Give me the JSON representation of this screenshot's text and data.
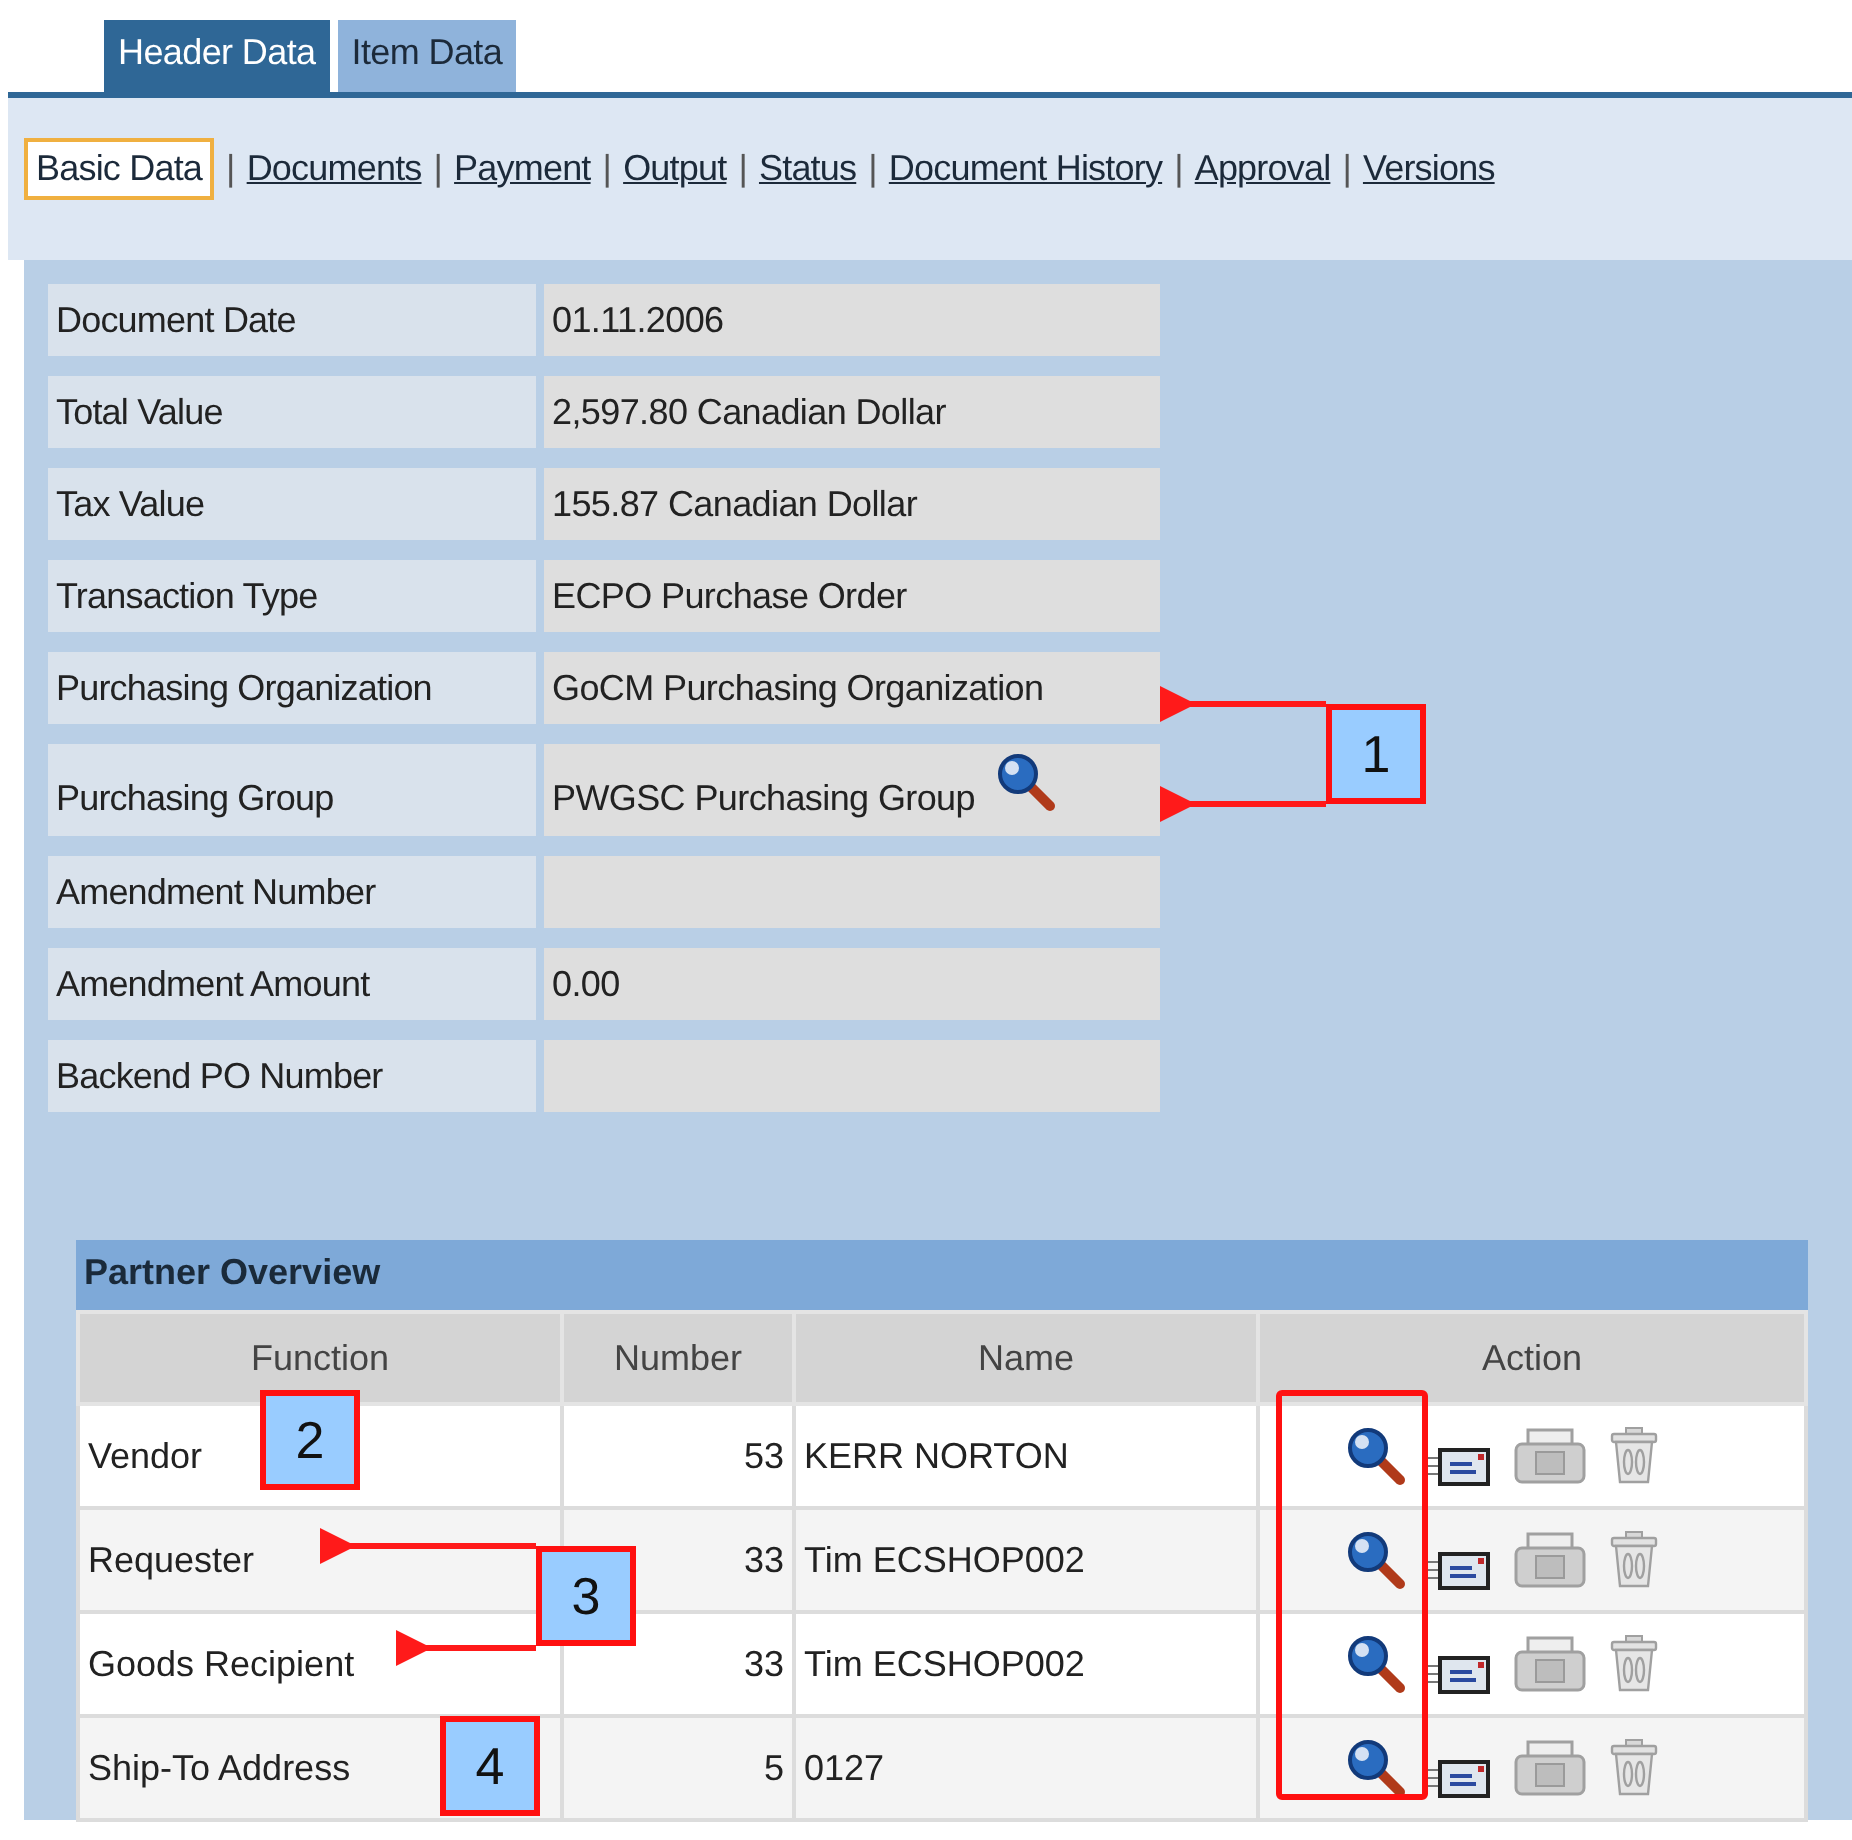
{
  "tabs": [
    {
      "label": "Header Data",
      "selected": true
    },
    {
      "label": "Item Data",
      "selected": false
    }
  ],
  "subnav": [
    {
      "label": "Basic Data",
      "selected": true
    },
    {
      "separator": "|",
      "label": "Documents",
      "selected": false
    },
    {
      "separator": "|",
      "label": "Payment",
      "selected": false
    },
    {
      "separator": "|",
      "label": "Output",
      "selected": false
    },
    {
      "separator": "|",
      "label": "Status",
      "selected": false
    },
    {
      "separator": "|",
      "label": "Document History",
      "selected": false
    },
    {
      "separator": "|",
      "label": "Approval",
      "selected": false
    },
    {
      "separator": "|",
      "label": "Versions",
      "selected": false
    }
  ],
  "fields": [
    {
      "label": "Document Date",
      "value": "01.11.2006",
      "kind": "text"
    },
    {
      "label": "Total Value",
      "value": "2,597.80  Canadian Dollar",
      "kind": "text"
    },
    {
      "label": "Tax Value",
      "value": "155.87  Canadian Dollar",
      "kind": "text"
    },
    {
      "label": "Transaction Type",
      "value": "ECPO Purchase Order",
      "kind": "text"
    },
    {
      "label": "Purchasing Organization",
      "value": "GoCM Purchasing Organization",
      "kind": "text"
    },
    {
      "label": "Purchasing Group",
      "value": "PWGSC Purchasing Group",
      "kind": "search"
    },
    {
      "label": "Amendment Number",
      "kind": "text"
    },
    {
      "label": "Amendment Amount",
      "value": "0.00",
      "kind": "text"
    },
    {
      "label": "Backend PO Number",
      "kind": "text"
    }
  ],
  "partner_overview": {
    "title": "Partner Overview",
    "columns": [
      "Function",
      "Number",
      "Name",
      "Action"
    ],
    "rows": [
      {
        "function": "Vendor",
        "number": "53",
        "name": "KERR NORTON"
      },
      {
        "function": "Requester",
        "number": "33",
        "name": "Tim ECSHOP002"
      },
      {
        "function": "Goods Recipient",
        "number": "33",
        "name": "Tim ECSHOP002"
      },
      {
        "function": "Ship-To Address",
        "number": "5",
        "name": "0127"
      }
    ]
  },
  "callouts": [
    "1",
    "2",
    "3",
    "4"
  ]
}
